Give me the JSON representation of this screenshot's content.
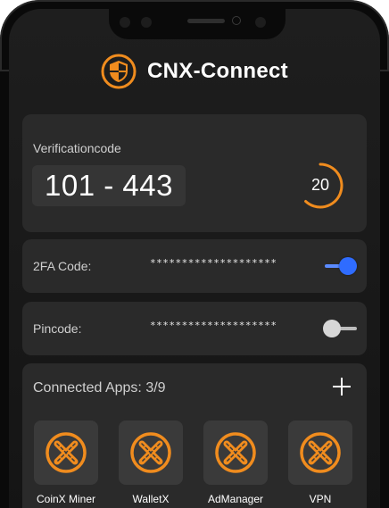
{
  "app": {
    "title": "CNX-Connect"
  },
  "verification": {
    "label": "Verificationcode",
    "code": "101 - 443",
    "timer_seconds": "20",
    "timer_progress_fraction": 0.62
  },
  "twofa": {
    "label": "2FA Code:",
    "value": "********************",
    "enabled": true
  },
  "pincode": {
    "label": "Pincode:",
    "value": "********************",
    "enabled": false
  },
  "connected_apps": {
    "label": "Connected Apps: 3/9",
    "add_icon": "plus-icon",
    "apps": [
      {
        "name": "CoinX Miner",
        "icon": "cross-badge-icon"
      },
      {
        "name": "WalletX",
        "icon": "cross-badge-icon"
      },
      {
        "name": "AdManager",
        "icon": "cross-badge-icon"
      },
      {
        "name": "VPN",
        "icon": "cross-badge-icon"
      }
    ]
  },
  "colors": {
    "accent": "#F08C1E",
    "toggle_on": "#2F6CFF",
    "card_bg": "#2A2A2A",
    "screen_bg": "#1A1A1A"
  }
}
